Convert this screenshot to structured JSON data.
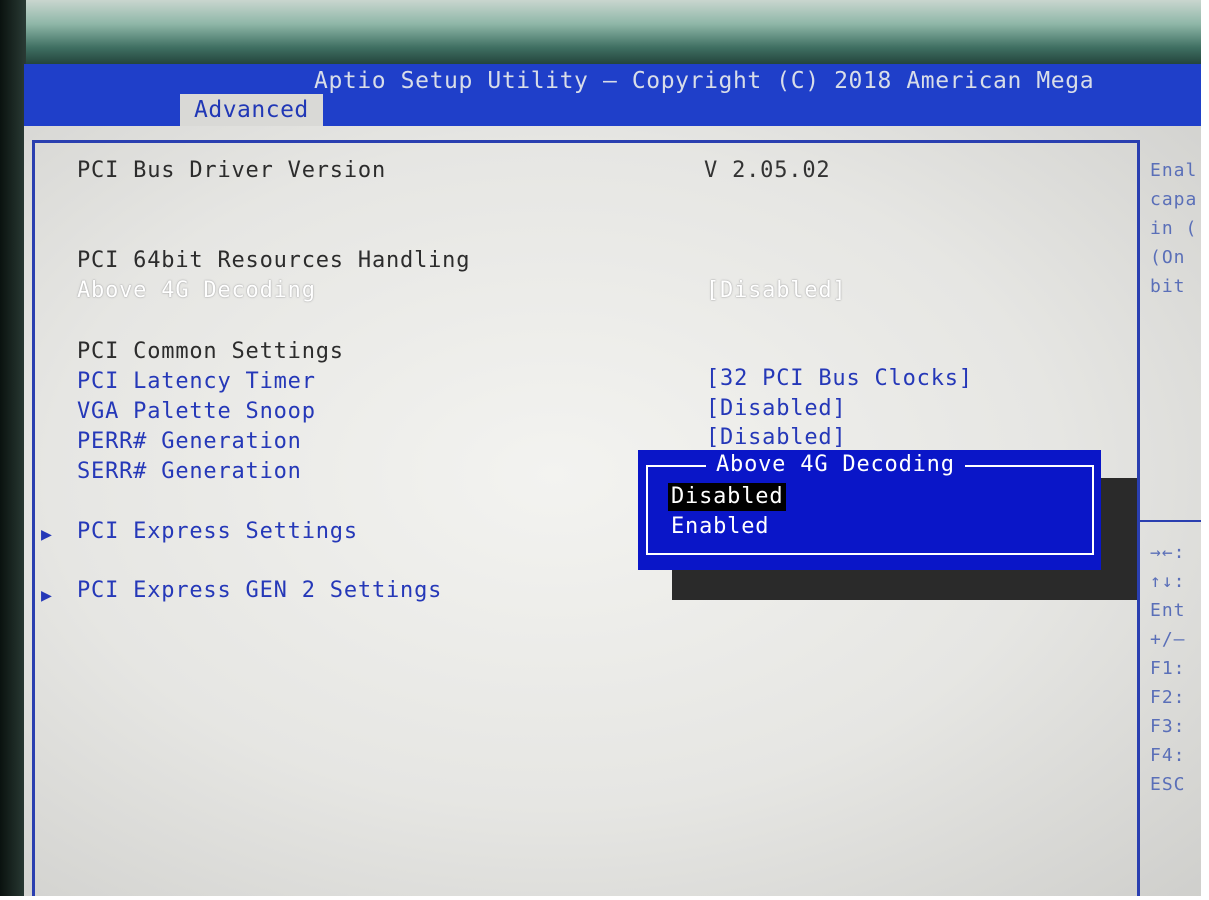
{
  "header": {
    "title": "Aptio Setup Utility – Copyright (C) 2018 American Mega",
    "active_tab": "Advanced"
  },
  "settings": {
    "pci_bus_driver_version": {
      "label": "PCI Bus Driver Version",
      "value": "V 2.05.02"
    },
    "pci_64bit_heading": "PCI 64bit Resources Handling",
    "above_4g": {
      "label": "Above 4G Decoding",
      "value": "[Disabled]"
    },
    "pci_common_heading": "PCI Common Settings",
    "pci_latency": {
      "label": "PCI Latency Timer",
      "value": "[32 PCI Bus Clocks]"
    },
    "vga_palette": {
      "label": "VGA Palette Snoop",
      "value": "[Disabled]"
    },
    "perr": {
      "label": "PERR# Generation",
      "value": "[Disabled]"
    },
    "serr": {
      "label": "SERR# Generation"
    },
    "pcie_settings": "PCI Express Settings",
    "pcie_gen2_settings": "PCI Express GEN 2 Settings",
    "submenu_arrow": "▶"
  },
  "popup": {
    "title": "Above 4G Decoding",
    "options": [
      "Disabled",
      "Enabled"
    ],
    "selected": "Disabled"
  },
  "help": {
    "description_lines": [
      "Enal",
      "capa",
      "in (",
      "(On",
      "bit"
    ],
    "keys": [
      "→←:",
      "↑↓:",
      "Ent",
      "+/–",
      "F1:",
      "F2:",
      "F3:",
      "F4:",
      "ESC"
    ]
  },
  "colors": {
    "title_bar": "#1f3fc9",
    "popup_bg": "#0a16c8",
    "panel_bg": "#e6e6e3",
    "label_blue": "#2538b8"
  }
}
